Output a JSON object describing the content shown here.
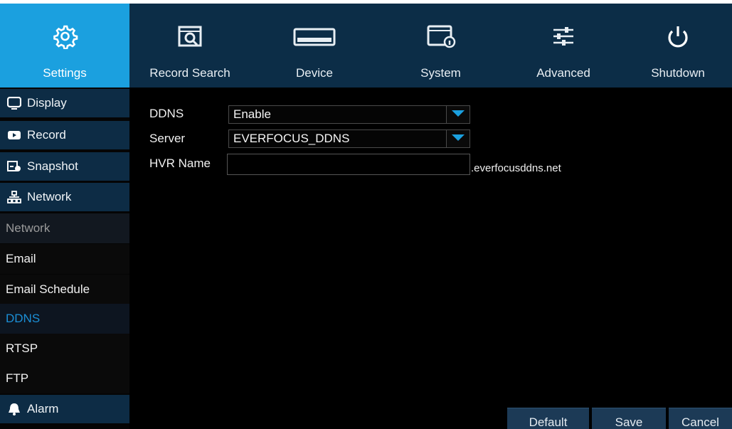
{
  "tabs": [
    {
      "id": "settings",
      "label": "Settings",
      "icon": "gear-icon",
      "active": true
    },
    {
      "id": "record-search",
      "label": "Record Search",
      "icon": "record-search-icon",
      "active": false
    },
    {
      "id": "device",
      "label": "Device",
      "icon": "hard-drive-icon",
      "active": false
    },
    {
      "id": "system",
      "label": "System",
      "icon": "system-info-icon",
      "active": false
    },
    {
      "id": "advanced",
      "label": "Advanced",
      "icon": "sliders-icon",
      "active": false
    },
    {
      "id": "shutdown",
      "label": "Shutdown",
      "icon": "power-icon",
      "active": false
    }
  ],
  "sidebar": {
    "items": [
      {
        "label": "Display",
        "icon": "monitor-icon"
      },
      {
        "label": "Record",
        "icon": "camera-icon"
      },
      {
        "label": "Snapshot",
        "icon": "snapshot-icon"
      },
      {
        "label": "Network",
        "icon": "network-icon"
      }
    ],
    "network_sub": [
      {
        "label": "Network",
        "state": "dim"
      },
      {
        "label": "Email",
        "state": "normal"
      },
      {
        "label": "Email Schedule",
        "state": "normal"
      },
      {
        "label": "DDNS",
        "state": "selected"
      },
      {
        "label": "RTSP",
        "state": "normal"
      },
      {
        "label": "FTP",
        "state": "normal"
      }
    ],
    "alarm": {
      "label": "Alarm",
      "icon": "bell-icon"
    }
  },
  "form": {
    "ddns": {
      "label": "DDNS",
      "value": "Enable"
    },
    "server": {
      "label": "Server",
      "value": "EVERFOCUS_DDNS"
    },
    "hvr_name": {
      "label": "HVR Name",
      "value": "",
      "placeholder": "",
      "suffix": ".everfocusddns.net"
    }
  },
  "buttons": {
    "default": "Default",
    "save": "Save",
    "cancel": "Cancel"
  },
  "colors": {
    "active_tab": "#1ba0df",
    "bar": "#0c2d47",
    "selected_text": "#1b8fd6"
  }
}
